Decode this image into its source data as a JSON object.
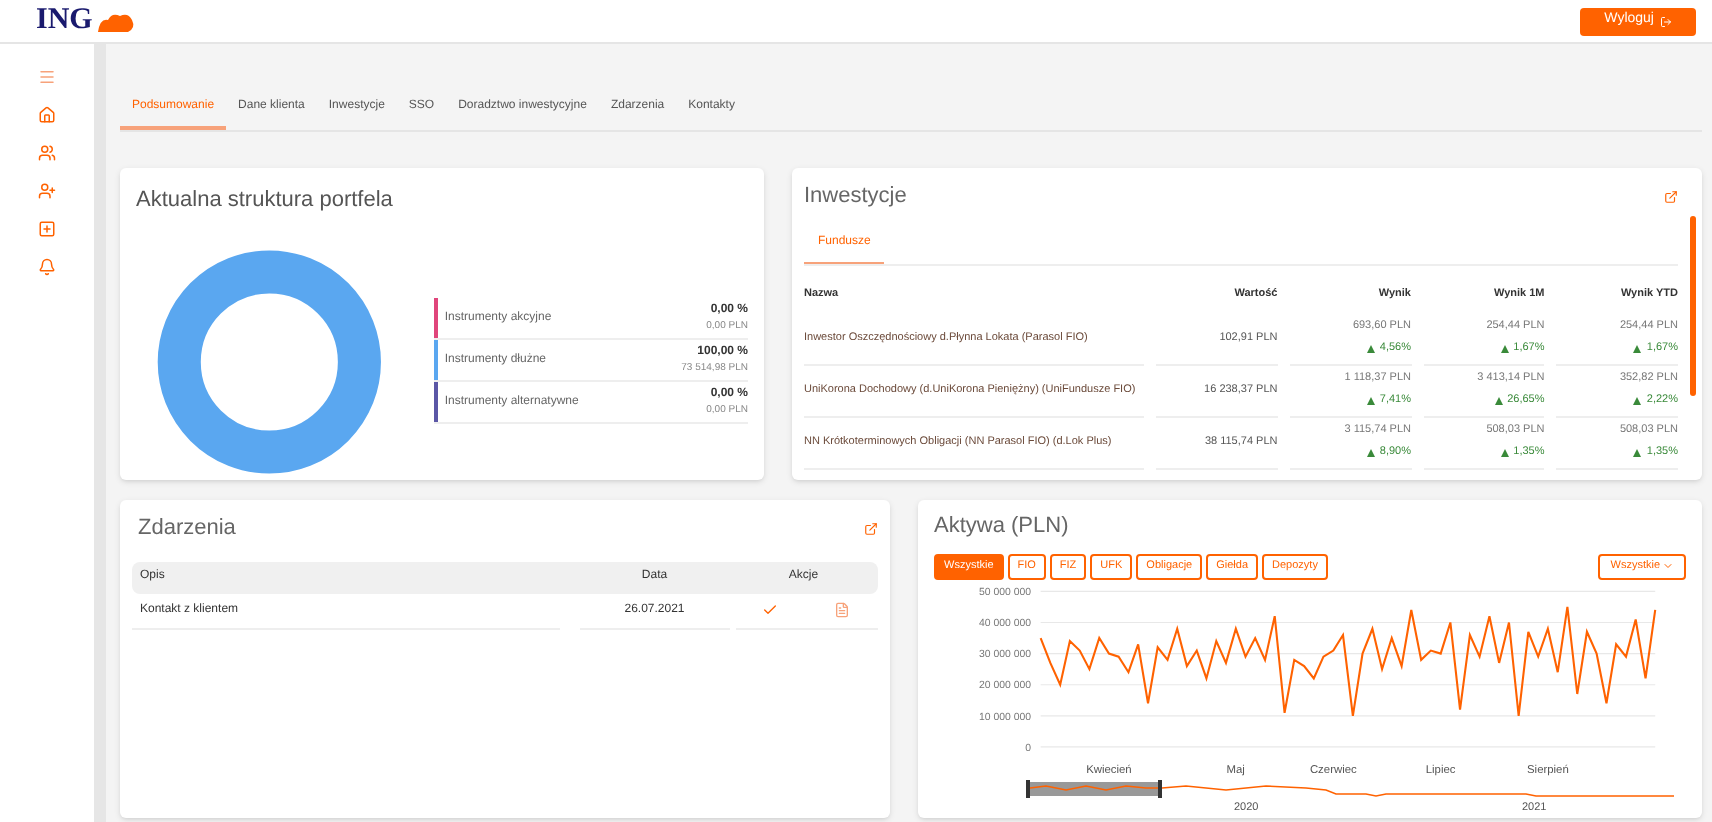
{
  "header": {
    "logo": "ING",
    "logout_button": "Wyloguj"
  },
  "tabs": [
    {
      "label": "Podsumowanie",
      "selected": true
    },
    {
      "label": "Dane klienta",
      "selected": false
    },
    {
      "label": "Inwestycje",
      "selected": false
    },
    {
      "label": "SSO",
      "selected": false
    },
    {
      "label": "Doradztwo inwestycyjne",
      "selected": false
    },
    {
      "label": "Zdarzenia",
      "selected": false
    },
    {
      "label": "Kontakty",
      "selected": false
    }
  ],
  "portfolio": {
    "title": "Aktualna struktura portfela",
    "segments": [
      {
        "label": "Instrumenty akcyjne",
        "percent": "0,00 %",
        "amount": "0,00 PLN",
        "color": "#e0457b",
        "level": 0
      },
      {
        "label": "Instrumenty dłużne",
        "percent": "100,00 %",
        "amount": "73 514,98 PLN",
        "color": "#5aa7f0",
        "level": 1
      },
      {
        "label": "Instrumenty alternatywne",
        "percent": "0,00 %",
        "amount": "0,00 PLN",
        "color": "#5b57a6",
        "level": 0
      }
    ]
  },
  "investments": {
    "title": "Inwestycje",
    "tabs": [
      {
        "label": "Fundusze",
        "selected": true
      }
    ],
    "columns": [
      "Nazwa",
      "Wartość",
      "Wynik",
      "Wynik 1M",
      "Wynik YTD"
    ],
    "rows": [
      {
        "name": "Inwestor Oszczędnościowy d.Płynna Lokata (Parasol FIO)",
        "value": "102,91 PLN",
        "result": {
          "amount": "693,60 PLN",
          "pct": "4,56%"
        },
        "result_1m": {
          "amount": "254,44 PLN",
          "pct": "1,67%"
        },
        "result_ytd": {
          "amount": "254,44 PLN",
          "pct": "1,67%"
        }
      },
      {
        "name": "UniKorona Dochodowy (d.UniKorona Pieniężny) (UniFundusze FIO)",
        "value": "16 238,37 PLN",
        "result": {
          "amount": "1 118,37 PLN",
          "pct": "7,41%"
        },
        "result_1m": {
          "amount": "3 413,14 PLN",
          "pct": "26,65%"
        },
        "result_ytd": {
          "amount": "352,82 PLN",
          "pct": "2,22%"
        }
      },
      {
        "name": "NN Krótkoterminowych Obligacji (NN Parasol FIO) (d.Lok Plus)",
        "value": "38 115,74 PLN",
        "result": {
          "amount": "3 115,74 PLN",
          "pct": "8,90%"
        },
        "result_1m": {
          "amount": "508,03 PLN",
          "pct": "1,35%"
        },
        "result_ytd": {
          "amount": "508,03 PLN",
          "pct": "1,35%"
        }
      }
    ]
  },
  "events": {
    "title": "Zdarzenia",
    "columns": [
      "Opis",
      "Data",
      "Akcje"
    ],
    "rows": [
      {
        "description": "Kontakt z klientem",
        "date": "26.07.2021"
      }
    ]
  },
  "assets": {
    "title": "Aktywa (PLN)",
    "filters": [
      {
        "label": "Wszystkie",
        "selected": true
      },
      {
        "label": "FIO",
        "selected": false
      },
      {
        "label": "FIZ",
        "selected": false
      },
      {
        "label": "UFK",
        "selected": false
      },
      {
        "label": "Obligacje",
        "selected": false
      },
      {
        "label": "Giełda",
        "selected": false
      },
      {
        "label": "Depozyty",
        "selected": false
      }
    ],
    "range_dropdown": "Wszystkie",
    "navigator_labels": [
      "2020",
      "2021"
    ],
    "chart_data": {
      "type": "line",
      "categories": [
        null,
        null,
        null,
        null,
        null,
        null,
        null,
        "Kwiecień",
        null,
        null,
        null,
        null,
        null,
        null,
        null,
        null,
        null,
        null,
        null,
        null,
        "Maj",
        null,
        null,
        null,
        null,
        null,
        null,
        null,
        null,
        null,
        "Czerwiec",
        null,
        null,
        null,
        null,
        null,
        null,
        null,
        null,
        null,
        null,
        "Lipiec",
        null,
        null,
        null,
        null,
        null,
        null,
        null,
        null,
        null,
        null,
        "Sierpień",
        null,
        null,
        null,
        null,
        null,
        null,
        null,
        null,
        null,
        null,
        null
      ],
      "yticks": [
        {
          "value": 0,
          "label": "0"
        },
        {
          "value": 10000000,
          "label": "10 000 000"
        },
        {
          "value": 20000000,
          "label": "20 000 000"
        },
        {
          "value": 30000000,
          "label": "30 000 000"
        },
        {
          "value": 40000000,
          "label": "40 000 000"
        },
        {
          "value": 50000000,
          "label": "50 000 000"
        }
      ],
      "ylim": [
        0,
        50000000
      ],
      "grid": true,
      "series": [
        {
          "color": "#ff6200",
          "values": [
            35000000,
            27000000,
            20000000,
            34000000,
            31000000,
            25000000,
            35000000,
            30000000,
            29000000,
            24000000,
            33000000,
            14000000,
            32000000,
            28000000,
            38000000,
            26000000,
            31000000,
            22000000,
            34000000,
            27000000,
            38000000,
            29000000,
            35000000,
            28000000,
            42000000,
            11000000,
            28000000,
            26000000,
            22000000,
            29000000,
            31000000,
            36000000,
            10000000,
            30000000,
            38000000,
            25000000,
            35000000,
            26000000,
            44000000,
            28000000,
            31000000,
            30000000,
            40000000,
            12000000,
            36000000,
            29000000,
            42000000,
            27000000,
            40000000,
            10000000,
            37000000,
            29000000,
            38000000,
            24000000,
            45000000,
            17000000,
            37000000,
            30000000,
            14000000,
            33000000,
            29000000,
            41000000,
            22000000,
            44000000
          ]
        }
      ]
    }
  }
}
